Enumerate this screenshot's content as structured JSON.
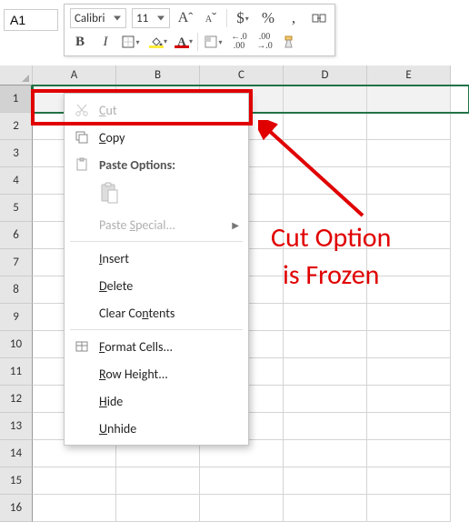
{
  "name_box": "A1",
  "toolbar": {
    "font_name": "Calibri",
    "font_size": "11",
    "bold": "B",
    "italic": "I",
    "accounting": "$",
    "percent": "%",
    "comma": ",",
    "inc_decimal_top": "←.0",
    "inc_decimal_bot": ".00",
    "dec_decimal_top": ".00",
    "dec_decimal_bot": "→.0"
  },
  "columns": [
    "A",
    "B",
    "C",
    "D",
    "E"
  ],
  "rows": [
    "1",
    "2",
    "3",
    "4",
    "5",
    "6",
    "7",
    "8",
    "9",
    "10",
    "11",
    "12",
    "13",
    "14",
    "15",
    "16"
  ],
  "selected_row_index": 0,
  "context_menu": {
    "cut": "Cut",
    "copy": "Copy",
    "paste_options": "Paste Options:",
    "paste_special": "Paste Special...",
    "insert": "Insert",
    "delete": "Delete",
    "clear_contents": "Clear Contents",
    "format_cells": "Format Cells...",
    "row_height": "Row Height...",
    "hide": "Hide",
    "unhide": "Unhide"
  },
  "annotation": {
    "line1": "Cut Option",
    "line2": "is Frozen"
  }
}
